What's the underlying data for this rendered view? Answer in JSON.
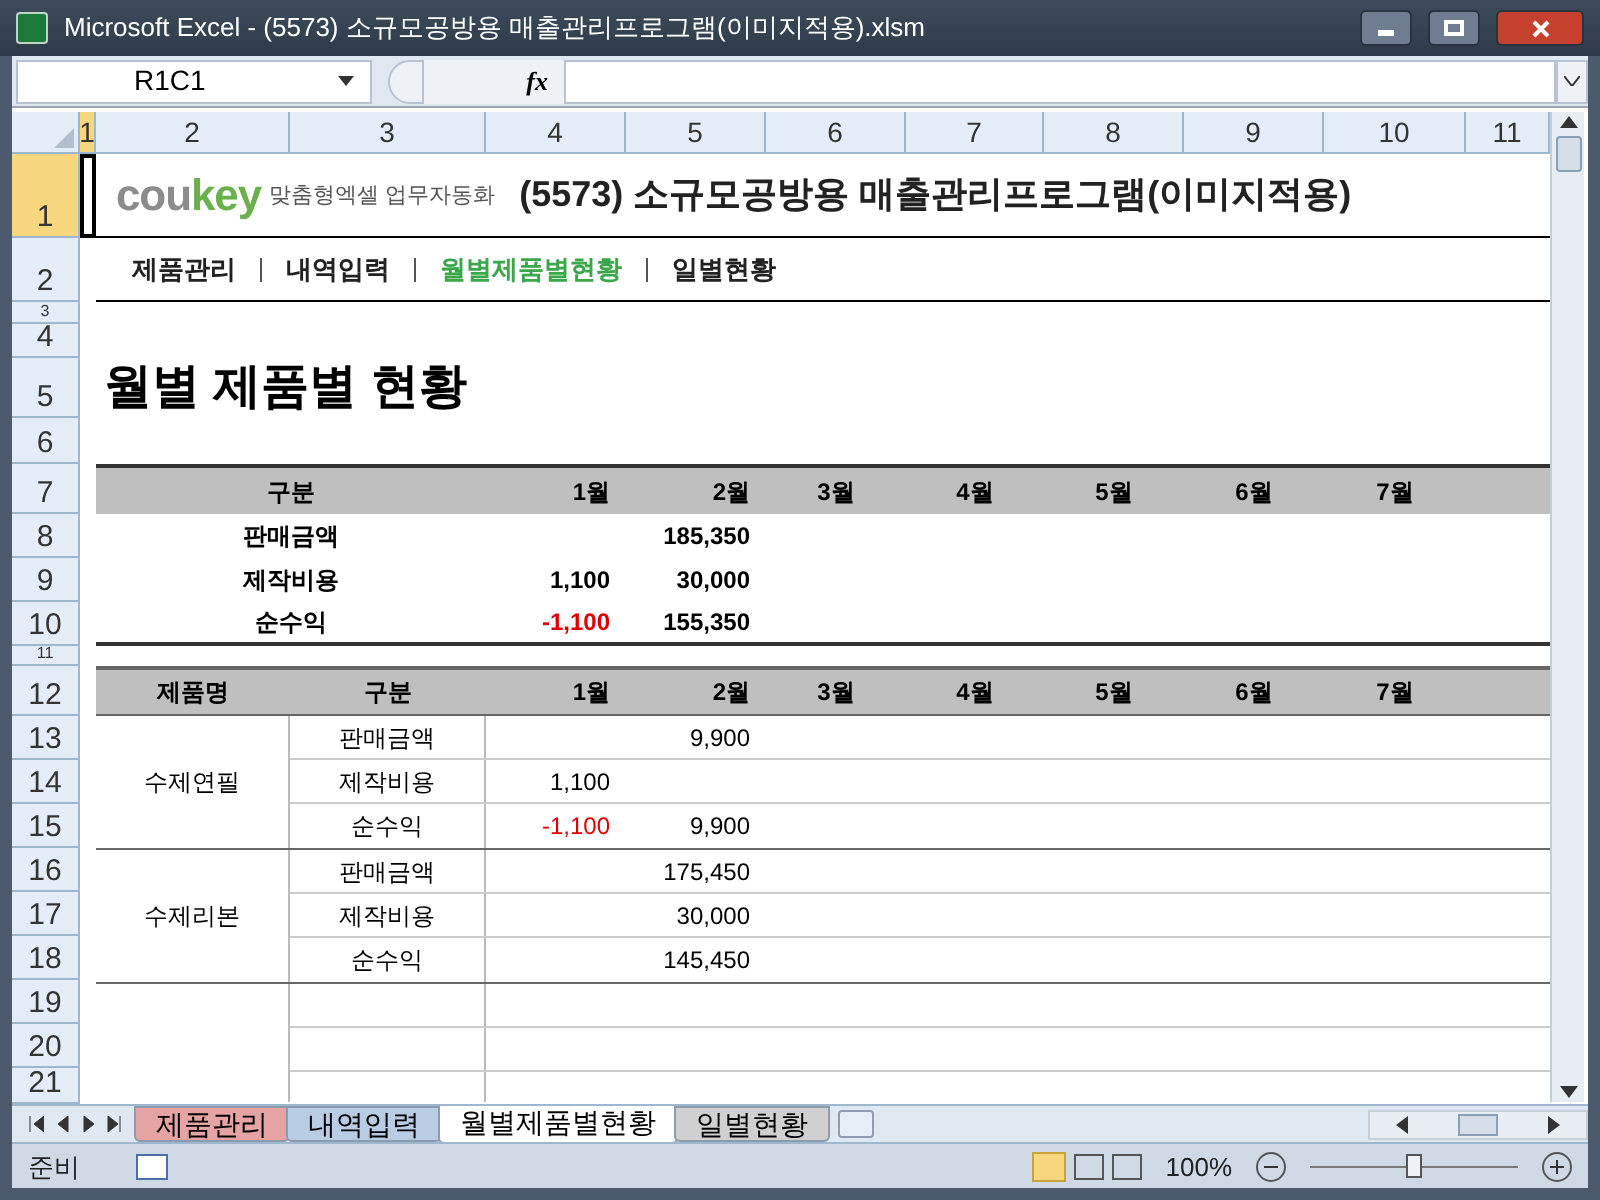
{
  "window": {
    "title": "Microsoft Excel - (5573) 소규모공방용 매출관리프로그램(이미지적용).xlsm"
  },
  "formula_bar": {
    "name_box": "R1C1",
    "fx": "fx"
  },
  "column_headers": [
    {
      "label": "1",
      "selected": true
    },
    {
      "label": "2",
      "selected": false
    },
    {
      "label": "3",
      "selected": false
    },
    {
      "label": "4",
      "selected": false
    },
    {
      "label": "5",
      "selected": false
    },
    {
      "label": "6",
      "selected": false
    },
    {
      "label": "7",
      "selected": false
    },
    {
      "label": "8",
      "selected": false
    },
    {
      "label": "9",
      "selected": false
    },
    {
      "label": "10",
      "selected": false
    },
    {
      "label": "11",
      "selected": false
    }
  ],
  "row_headers": [
    {
      "label": "1",
      "selected": true
    },
    {
      "label": "2",
      "selected": false
    },
    {
      "label": "3",
      "selected": false
    },
    {
      "label": "4",
      "selected": false
    },
    {
      "label": "5",
      "selected": false
    },
    {
      "label": "6",
      "selected": false
    },
    {
      "label": "7",
      "selected": false
    },
    {
      "label": "8",
      "selected": false
    },
    {
      "label": "9",
      "selected": false
    },
    {
      "label": "10",
      "selected": false
    },
    {
      "label": "11",
      "selected": false
    },
    {
      "label": "12",
      "selected": false
    },
    {
      "label": "13",
      "selected": false
    },
    {
      "label": "14",
      "selected": false
    },
    {
      "label": "15",
      "selected": false
    },
    {
      "label": "16",
      "selected": false
    },
    {
      "label": "17",
      "selected": false
    },
    {
      "label": "18",
      "selected": false
    },
    {
      "label": "19",
      "selected": false
    },
    {
      "label": "20",
      "selected": false
    },
    {
      "label": "21",
      "selected": false
    }
  ],
  "header": {
    "logo_parts": [
      "cou",
      "key"
    ],
    "logo_tagline": "맞춤형엑셀 업무자동화",
    "title": "(5573) 소규모공방용 매출관리프로그램(이미지적용)"
  },
  "nav": [
    {
      "label": "제품관리",
      "selected": false
    },
    {
      "label": "내역입력",
      "selected": false
    },
    {
      "label": "월별제품별현황",
      "selected": true
    },
    {
      "label": "일별현황",
      "selected": false
    }
  ],
  "page_heading": "월별 제품별 현황",
  "summary": {
    "columns": [
      "구분",
      "1월",
      "2월",
      "3월",
      "4월",
      "5월",
      "6월",
      "7월"
    ],
    "rows": [
      {
        "cells": [
          {
            "text": "판매금액",
            "negative": false
          },
          null,
          {
            "text": "185,350",
            "negative": false
          },
          null,
          null,
          null,
          null,
          null
        ]
      },
      {
        "cells": [
          {
            "text": "제작비용",
            "negative": false
          },
          {
            "text": "1,100",
            "negative": false
          },
          {
            "text": "30,000",
            "negative": false
          },
          null,
          null,
          null,
          null,
          null
        ]
      },
      {
        "cells": [
          {
            "text": "순수익",
            "negative": false
          },
          {
            "text": "-1,100",
            "negative": true
          },
          {
            "text": "155,350",
            "negative": false
          },
          null,
          null,
          null,
          null,
          null
        ]
      }
    ]
  },
  "detail": {
    "columns": [
      "제품명",
      "구분",
      "1월",
      "2월",
      "3월",
      "4월",
      "5월",
      "6월",
      "7월"
    ],
    "groups": [
      {
        "product": "수제연필",
        "rows": [
          {
            "label": "판매금액",
            "cells": [
              null,
              {
                "text": "9,900",
                "negative": false
              },
              null,
              null,
              null,
              null,
              null
            ]
          },
          {
            "label": "제작비용",
            "cells": [
              {
                "text": "1,100",
                "negative": false
              },
              null,
              null,
              null,
              null,
              null,
              null
            ]
          },
          {
            "label": "순수익",
            "cells": [
              {
                "text": "-1,100",
                "negative": true
              },
              {
                "text": "9,900",
                "negative": false
              },
              null,
              null,
              null,
              null,
              null
            ]
          }
        ]
      },
      {
        "product": "수제리본",
        "rows": [
          {
            "label": "판매금액",
            "cells": [
              null,
              {
                "text": "175,450",
                "negative": false
              },
              null,
              null,
              null,
              null,
              null
            ]
          },
          {
            "label": "제작비용",
            "cells": [
              null,
              {
                "text": "30,000",
                "negative": false
              },
              null,
              null,
              null,
              null,
              null
            ]
          },
          {
            "label": "순수익",
            "cells": [
              null,
              {
                "text": "145,450",
                "negative": false
              },
              null,
              null,
              null,
              null,
              null
            ]
          }
        ]
      }
    ]
  },
  "sheet_tabs": [
    {
      "label": "제품관리",
      "selected": false,
      "color": "#e6a3a3"
    },
    {
      "label": "내역입력",
      "selected": false,
      "color": "#b8cce4"
    },
    {
      "label": "월별제품별현황",
      "selected": true,
      "color": "#ffffff"
    },
    {
      "label": "일별현황",
      "selected": false,
      "color": "#d0d0d0"
    }
  ],
  "status_bar": {
    "status": "준비",
    "zoom": "100%",
    "zoom_slider": {
      "level": 0.5
    }
  }
}
